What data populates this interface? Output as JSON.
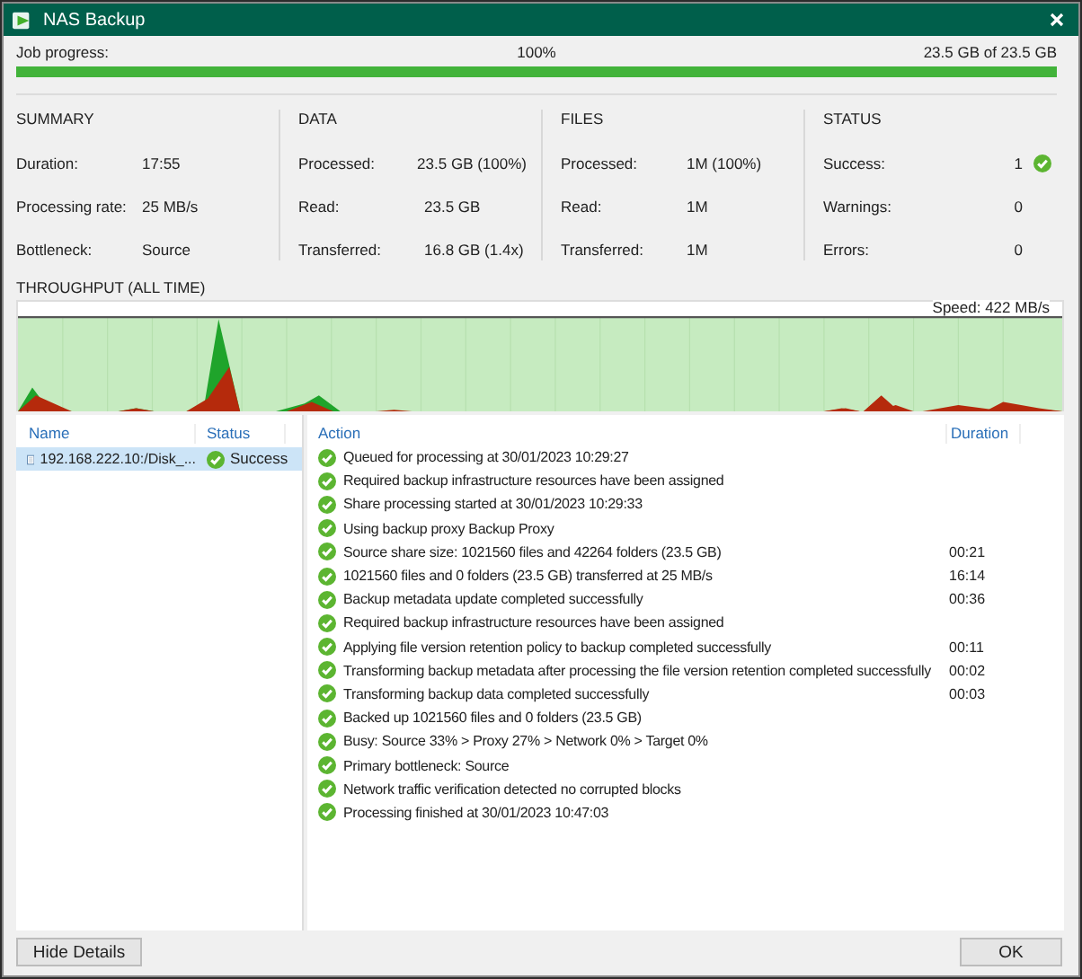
{
  "window": {
    "title": "NAS Backup"
  },
  "job_progress": {
    "label": "Job progress:",
    "percent": "100%",
    "amount": "23.5 GB of 23.5 GB",
    "level": 1
  },
  "sections": [
    {
      "title": "SUMMARY",
      "rows": [
        {
          "label": "Duration:",
          "value": "17:55"
        },
        {
          "label": "Processing rate:",
          "value": "25 MB/s"
        },
        {
          "label": "Bottleneck:",
          "value": "Source"
        }
      ]
    },
    {
      "title": "DATA",
      "rows": [
        {
          "label": "Processed:",
          "value": "23.5 GB (100%)"
        },
        {
          "label": "Read:",
          "value": "23.5 GB"
        },
        {
          "label": "Transferred:",
          "value": "16.8 GB (1.4x)"
        }
      ]
    },
    {
      "title": "FILES",
      "rows": [
        {
          "label": "Processed:",
          "value": "1M (100%)"
        },
        {
          "label": "Read:",
          "value": "1M"
        },
        {
          "label": "Transferred:",
          "value": "1M"
        }
      ]
    },
    {
      "title": "STATUS",
      "rows": [
        {
          "label": "Success:",
          "value": "1",
          "kind": "success"
        },
        {
          "label": "Warnings:",
          "value": "0",
          "kind": "warning"
        },
        {
          "label": "Errors:",
          "value": "0",
          "kind": "error"
        }
      ]
    }
  ],
  "throughput": {
    "title": "THROUGHPUT (ALL TIME)",
    "speed": "Speed: 422 MB/s"
  },
  "objects_table": {
    "columns": [
      "Name",
      "Status"
    ],
    "rows": [
      {
        "name": "192.168.222.10:/Disk_...",
        "status": "Success",
        "selected": true
      }
    ]
  },
  "actions_table": {
    "columns": [
      "Action",
      "Duration"
    ],
    "rows": [
      {
        "action": "Queued for processing at 30/01/2023 10:29:27"
      },
      {
        "action": "Required backup infrastructure resources have been assigned"
      },
      {
        "action": "Share processing started at 30/01/2023 10:29:33"
      },
      {
        "action": "Using backup proxy Backup Proxy"
      },
      {
        "action": "Source share size: 1021560 files and 42264 folders (23.5 GB)",
        "duration": "00:21"
      },
      {
        "action": "1021560 files and 0 folders (23.5 GB) transferred at 25 MB/s",
        "duration": "16:14"
      },
      {
        "action": "Backup metadata update completed successfully",
        "duration": "00:36"
      },
      {
        "action": "Required backup infrastructure resources have been assigned"
      },
      {
        "action": "Applying file version retention policy to backup completed successfully",
        "duration": "00:11"
      },
      {
        "action": "Transforming backup metadata after processing the file version retention completed successfully",
        "duration": "00:02"
      },
      {
        "action": "Transforming backup data completed successfully",
        "duration": "00:03"
      },
      {
        "action": "Backed up 1021560 files and 0 folders (23.5 GB)"
      },
      {
        "action": "Busy: Source 33% > Proxy 27% > Network 0% > Target 0%"
      },
      {
        "action": "Primary bottleneck: Source"
      },
      {
        "action": "Network traffic verification detected no corrupted blocks"
      },
      {
        "action": "Processing finished at 30/01/2023 10:47:03"
      }
    ]
  },
  "buttons": {
    "left": "Hide Details",
    "right": "OK"
  }
}
